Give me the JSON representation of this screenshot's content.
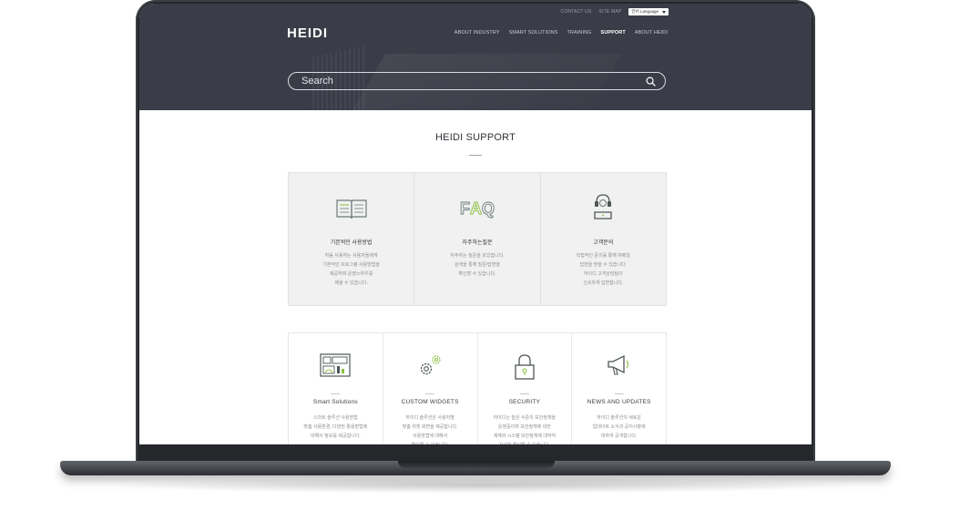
{
  "utility": {
    "contact": "CONTACT US",
    "sitemap": "SITE MAP",
    "language": "언어 Language"
  },
  "header": {
    "logo": "HEIDI",
    "nav": [
      {
        "label": "ABOUT INDUSTRY"
      },
      {
        "label": "SMART SOLUTIONS"
      },
      {
        "label": "TRAINING"
      },
      {
        "label": "SUPPORT",
        "active": true
      },
      {
        "label": "ABOUT HEIDI"
      }
    ]
  },
  "search": {
    "placeholder": "Search"
  },
  "section": {
    "title": "HEIDI SUPPORT"
  },
  "cards_top": [
    {
      "icon": "book-icon",
      "title": "기본적인 사용방법",
      "desc": "처음 사용하는 사용자들에게\n기본적인 프로그램 사용방법을\n제공하며 운영노하우를\n배울 수 있습니다."
    },
    {
      "icon": "faq-icon",
      "title": "자주하는질문",
      "desc": "자주하는 질문을 모았습니다.\n검색을 통해 질문/답변을\n확인할 수 있습니다."
    },
    {
      "icon": "headset-icon",
      "title": "고객문의",
      "desc": "직접적인 문의를 통해 여쭤일\n답변을 받을 수 있습니다.\n하이디 고객상담팀이\n신속하게 답변합니다."
    }
  ],
  "cards_bottom": [
    {
      "icon": "dashboard-icon",
      "title": "Smart Solutions",
      "desc": "스마트 솔루션 사용방법\n맞춤 사용환경, 다양한 활용방법에\n대해서 정보를 제공합니다."
    },
    {
      "icon": "gears-icon",
      "title": "CUSTOM WIDGETS",
      "desc": "하이디 솔루션은 사용자별\n맞춤 위젯 화면을 제공합니다.\n사용방법에 대해서\n확인할 수 있습니다."
    },
    {
      "icon": "lock-icon",
      "title": "SECURITY",
      "desc": "하이디는 높은 수준의 보안정책을\n운영중이며 보안정책에 대한\n계계와 시스템 보안정책에 대하여\n자세히 확인할 수 있습니다."
    },
    {
      "icon": "megaphone-icon",
      "title": "NEWS AND UPDATES",
      "desc": "하이디 솔루션의 새로운\n업데이트 소식과 공지사항에\n대하여 공개합니다."
    }
  ],
  "colors": {
    "header_bg": "#3a3d47",
    "accent_green": "#8bbf3f",
    "laptop_frame": "#26282c"
  }
}
